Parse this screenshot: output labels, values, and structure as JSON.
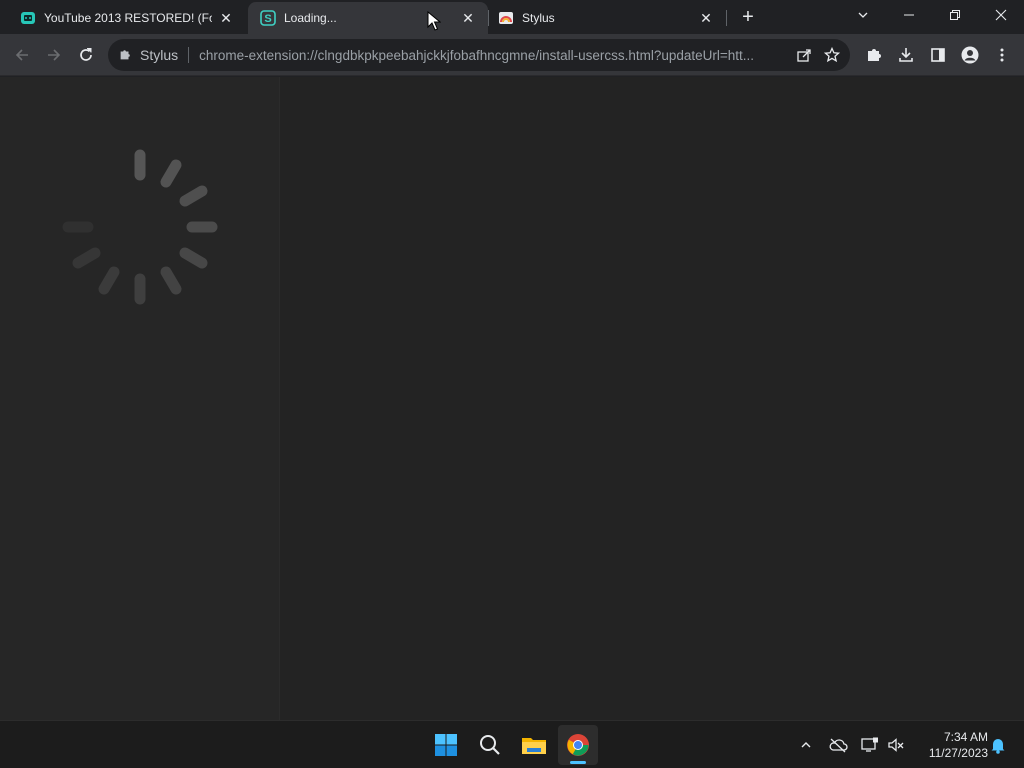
{
  "tabs": [
    {
      "title": "YouTube 2013 RESTORED! (For R",
      "favicon": "youtube-restored-icon",
      "active": false
    },
    {
      "title": "Loading...",
      "favicon": "stylus-s-icon",
      "active": true
    },
    {
      "title": "Stylus",
      "favicon": "stylus-logo-icon",
      "active": false
    }
  ],
  "omnibox": {
    "chip_label": "Stylus",
    "chip_icon": "puzzle-icon",
    "url": "chrome-extension://clngdbkpkpeebahjckkjfobafhncgmne/install-usercss.html?updateUrl=htt..."
  },
  "page": {
    "state": "loading",
    "spinner": "loading-spinner"
  },
  "taskbar": {
    "apps": [
      "windows-start-icon",
      "search-icon",
      "file-explorer-icon",
      "chrome-icon"
    ],
    "time": "7:34 AM",
    "date": "11/27/2023"
  },
  "colors": {
    "tabstrip_bg": "#202124",
    "toolbar_bg": "#35363a",
    "content_bg": "#232323",
    "sidebar_bg": "#262626",
    "accent": "#4cc2ff"
  }
}
